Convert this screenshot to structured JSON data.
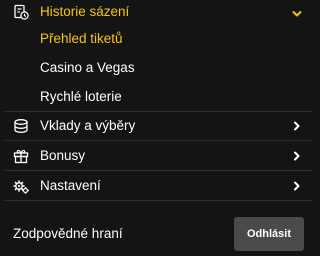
{
  "colors": {
    "accent": "#f5c518",
    "background": "#141414",
    "text": "#ffffff",
    "divider": "#2f2f2f",
    "button_bg": "#4a4a4a"
  },
  "menu": {
    "history": {
      "label": "Historie sázení",
      "icon": "history-receipt-icon",
      "expanded": true,
      "subitems": [
        {
          "label": "Přehled tiketů",
          "active": true
        },
        {
          "label": "Casino a Vegas",
          "active": false
        },
        {
          "label": "Rychlé loterie",
          "active": false
        }
      ]
    },
    "deposits": {
      "label": "Vklady a výběry",
      "icon": "coins-icon"
    },
    "bonuses": {
      "label": "Bonusy",
      "icon": "gift-icon"
    },
    "settings": {
      "label": "Nastavení",
      "icon": "gears-icon"
    }
  },
  "footer": {
    "responsible_label": "Zodpovědné hraní",
    "logout_label": "Odhlásit"
  }
}
